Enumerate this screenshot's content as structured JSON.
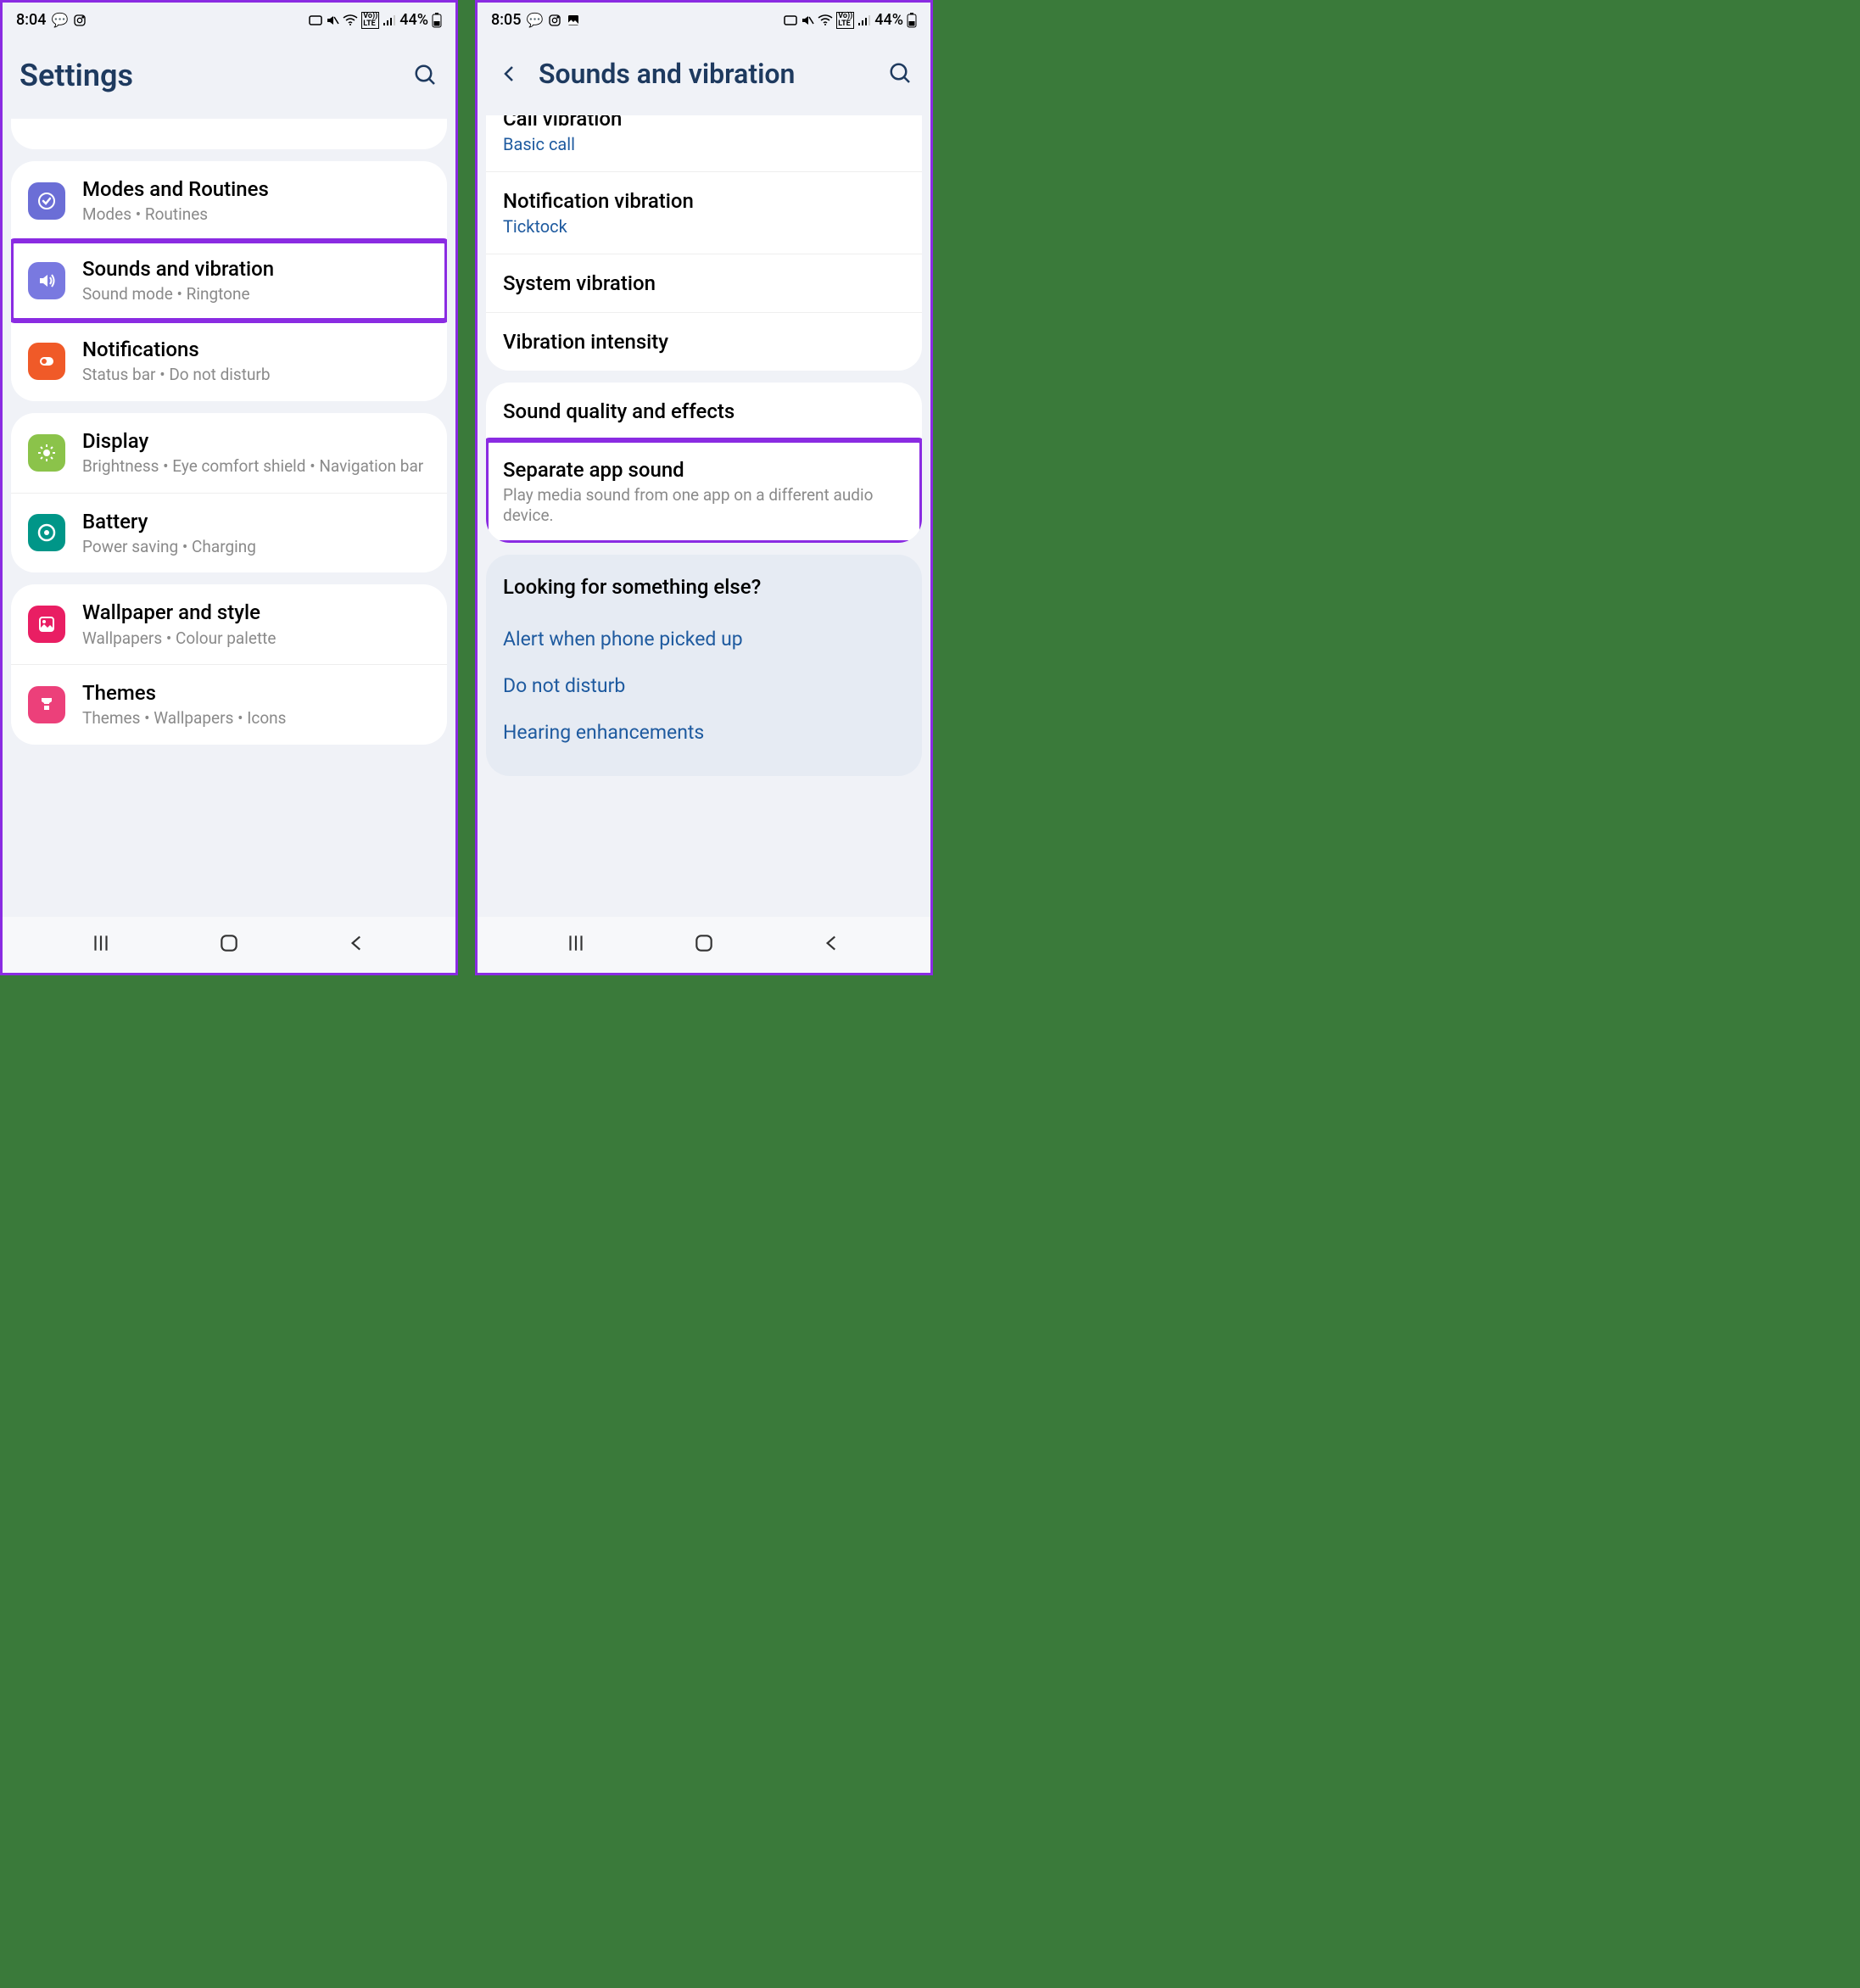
{
  "left": {
    "status": {
      "time": "8:04",
      "battery": "44%"
    },
    "header": {
      "title": "Settings"
    },
    "groups": [
      {
        "items": [
          {
            "key": "modes",
            "title": "Modes and Routines",
            "sub": "Modes  •  Routines"
          },
          {
            "key": "sounds",
            "title": "Sounds and vibration",
            "sub": "Sound mode  •  Ringtone",
            "highlight": true
          },
          {
            "key": "notifications",
            "title": "Notifications",
            "sub": "Status bar  •  Do not disturb"
          }
        ]
      },
      {
        "items": [
          {
            "key": "display",
            "title": "Display",
            "sub": "Brightness  •  Eye comfort shield  •  Navigation bar"
          },
          {
            "key": "battery",
            "title": "Battery",
            "sub": "Power saving  •  Charging"
          }
        ]
      },
      {
        "items": [
          {
            "key": "wallpaper",
            "title": "Wallpaper and style",
            "sub": "Wallpapers  •  Colour palette"
          },
          {
            "key": "themes",
            "title": "Themes",
            "sub": "Themes  •  Wallpapers  •  Icons"
          }
        ]
      }
    ]
  },
  "right": {
    "status": {
      "time": "8:05",
      "battery": "44%"
    },
    "header": {
      "title": "Sounds and vibration"
    },
    "group1": [
      {
        "key": "callvib",
        "title": "Call vibration",
        "value": "Basic call",
        "partial": true
      },
      {
        "key": "notifvib",
        "title": "Notification vibration",
        "value": "Ticktock"
      },
      {
        "key": "sysvib",
        "title": "System vibration"
      },
      {
        "key": "vibint",
        "title": "Vibration intensity"
      }
    ],
    "group2": [
      {
        "key": "soundquality",
        "title": "Sound quality and effects"
      },
      {
        "key": "separate",
        "title": "Separate app sound",
        "sub": "Play media sound from one app on a different audio device.",
        "highlight": true
      }
    ],
    "footer": {
      "title": "Looking for something else?",
      "links": [
        "Alert when phone picked up",
        "Do not disturb",
        "Hearing enhancements"
      ]
    }
  }
}
